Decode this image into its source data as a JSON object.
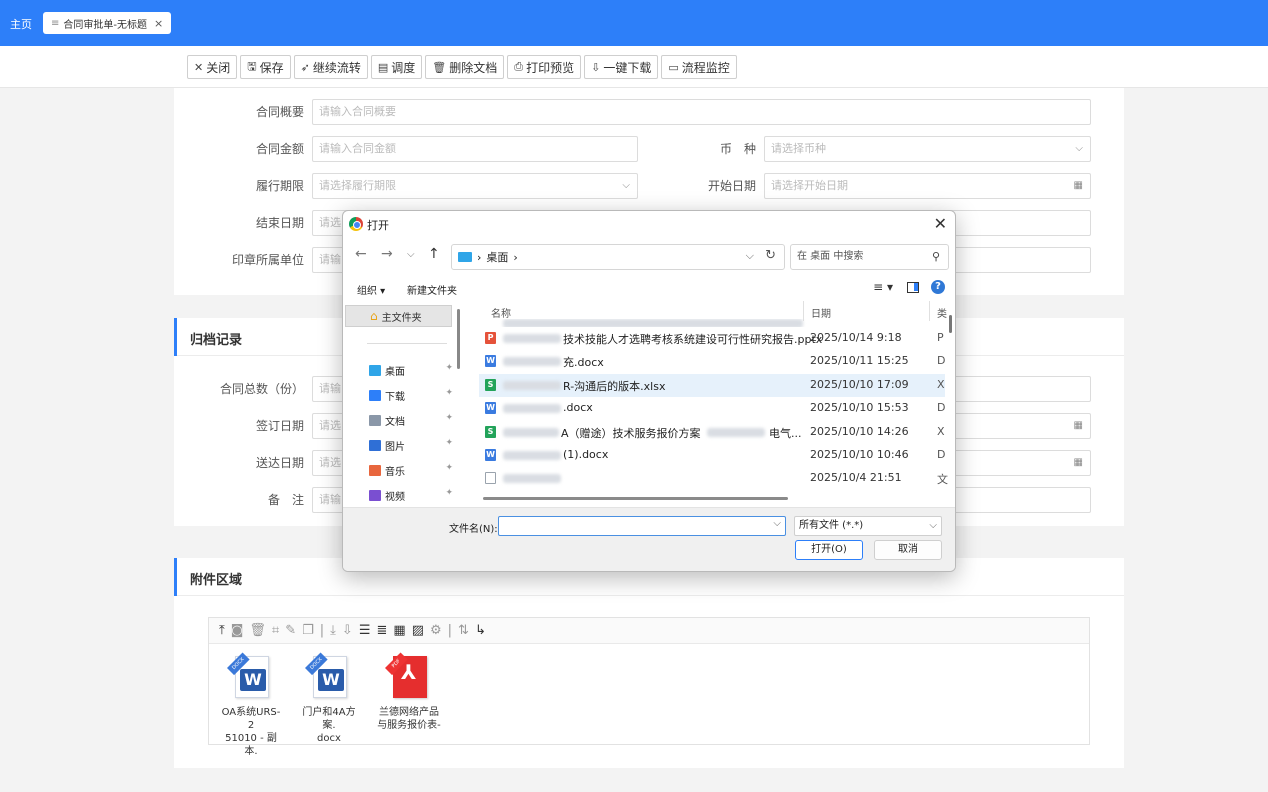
{
  "topbar": {
    "home": "主页",
    "tab_label": "合同审批单-无标题",
    "tab_close": "×",
    "tab_menu": "≡"
  },
  "toolbar": {
    "buttons": [
      {
        "icon": "✕",
        "label": "关闭"
      },
      {
        "icon": "🖫",
        "label": "保存"
      },
      {
        "icon": "➶",
        "label": "继续流转"
      },
      {
        "icon": "▤",
        "label": "调度"
      },
      {
        "icon": "🗑",
        "label": "删除文档"
      },
      {
        "icon": "⎙",
        "label": "打印预览"
      },
      {
        "icon": "⇩",
        "label": "一键下载"
      },
      {
        "icon": "▭",
        "label": "流程监控"
      }
    ]
  },
  "form": {
    "summary_label": "合同概要",
    "summary_ph": "请输入合同概要",
    "amount_label": "合同金额",
    "amount_ph": "请输入合同金额",
    "currency_label": "币　种",
    "currency_ph": "请选择币种",
    "period_label": "履行期限",
    "period_ph": "请选择履行期限",
    "start_label": "开始日期",
    "start_ph": "请选择开始日期",
    "end_label": "结束日期",
    "end_ph": "请选",
    "seal_label": "印章所属单位",
    "seal_ph": "请输"
  },
  "archive": {
    "title": "归档记录",
    "total_label": "合同总数（份）",
    "total_ph": "请输",
    "sign_label": "签订日期",
    "sign_ph": "请选",
    "deliver_label": "送达日期",
    "deliver_ph": "请选",
    "remark_label": "备　注",
    "remark_ph": "请输"
  },
  "attachments": {
    "title": "附件区域",
    "files": [
      {
        "line1": "OA系统URS-2",
        "line2": "51010 - 副本.",
        "kind": "word",
        "tag": "DOCX"
      },
      {
        "line1": "门户和4A方案.",
        "line2": "docx",
        "kind": "word",
        "tag": "DOCX"
      },
      {
        "line1": "兰德网络产品",
        "line2": "与服务报价表-",
        "kind": "pdf",
        "tag": "PDF"
      }
    ]
  },
  "dialog": {
    "title": "打开",
    "close": "✕",
    "address": "桌面",
    "search_ph": "在 桌面 中搜索",
    "organize": "组织 ▾",
    "new_folder": "新建文件夹",
    "nav": {
      "home": "主文件夹",
      "items": [
        {
          "label": "桌面",
          "color": "#2fa5e8"
        },
        {
          "label": "下载",
          "color": "#2d7ff9"
        },
        {
          "label": "文档",
          "color": "#8a97a8"
        },
        {
          "label": "图片",
          "color": "#2f6fd6"
        },
        {
          "label": "音乐",
          "color": "#e8663d"
        },
        {
          "label": "视频",
          "color": "#7a4fd1"
        }
      ]
    },
    "columns": {
      "name": "名称",
      "date": "日期",
      "type": "类"
    },
    "files": [
      {
        "icon": "P",
        "color": "#e5523a",
        "name": "技术技能人才选聘考核系统建设可行性研究报告.pptx",
        "date": "2025/10/14 9:18",
        "type": "P",
        "blur": 58
      },
      {
        "icon": "W",
        "color": "#3a7be0",
        "name": "充.docx",
        "date": "2025/10/11 15:25",
        "type": "D",
        "blur": 58
      },
      {
        "icon": "S",
        "color": "#23a35a",
        "name": "R-沟通后的版本.xlsx",
        "date": "2025/10/10 17:09",
        "type": "X",
        "blur": 58,
        "selected": true
      },
      {
        "icon": "W",
        "color": "#3a7be0",
        "name": ".docx",
        "date": "2025/10/10 15:53",
        "type": "D",
        "blur": 58
      },
      {
        "icon": "S",
        "color": "#23a35a",
        "name": "A（赠途）技术服务报价方案",
        "tail": "电气...",
        "date": "2025/10/10 14:26",
        "type": "X",
        "blur": 56
      },
      {
        "icon": "W",
        "color": "#3a7be0",
        "name": "(1).docx",
        "date": "2025/10/10 10:46",
        "type": "D",
        "blur": 58
      },
      {
        "icon": "",
        "color": "#9aa3ad",
        "name": "",
        "date": "2025/10/4 21:51",
        "type": "文",
        "blur": 58
      }
    ],
    "filename_label": "文件名(N):",
    "filetype": "所有文件 (*.*)",
    "open_btn": "打开(O)",
    "cancel_btn": "取消"
  }
}
